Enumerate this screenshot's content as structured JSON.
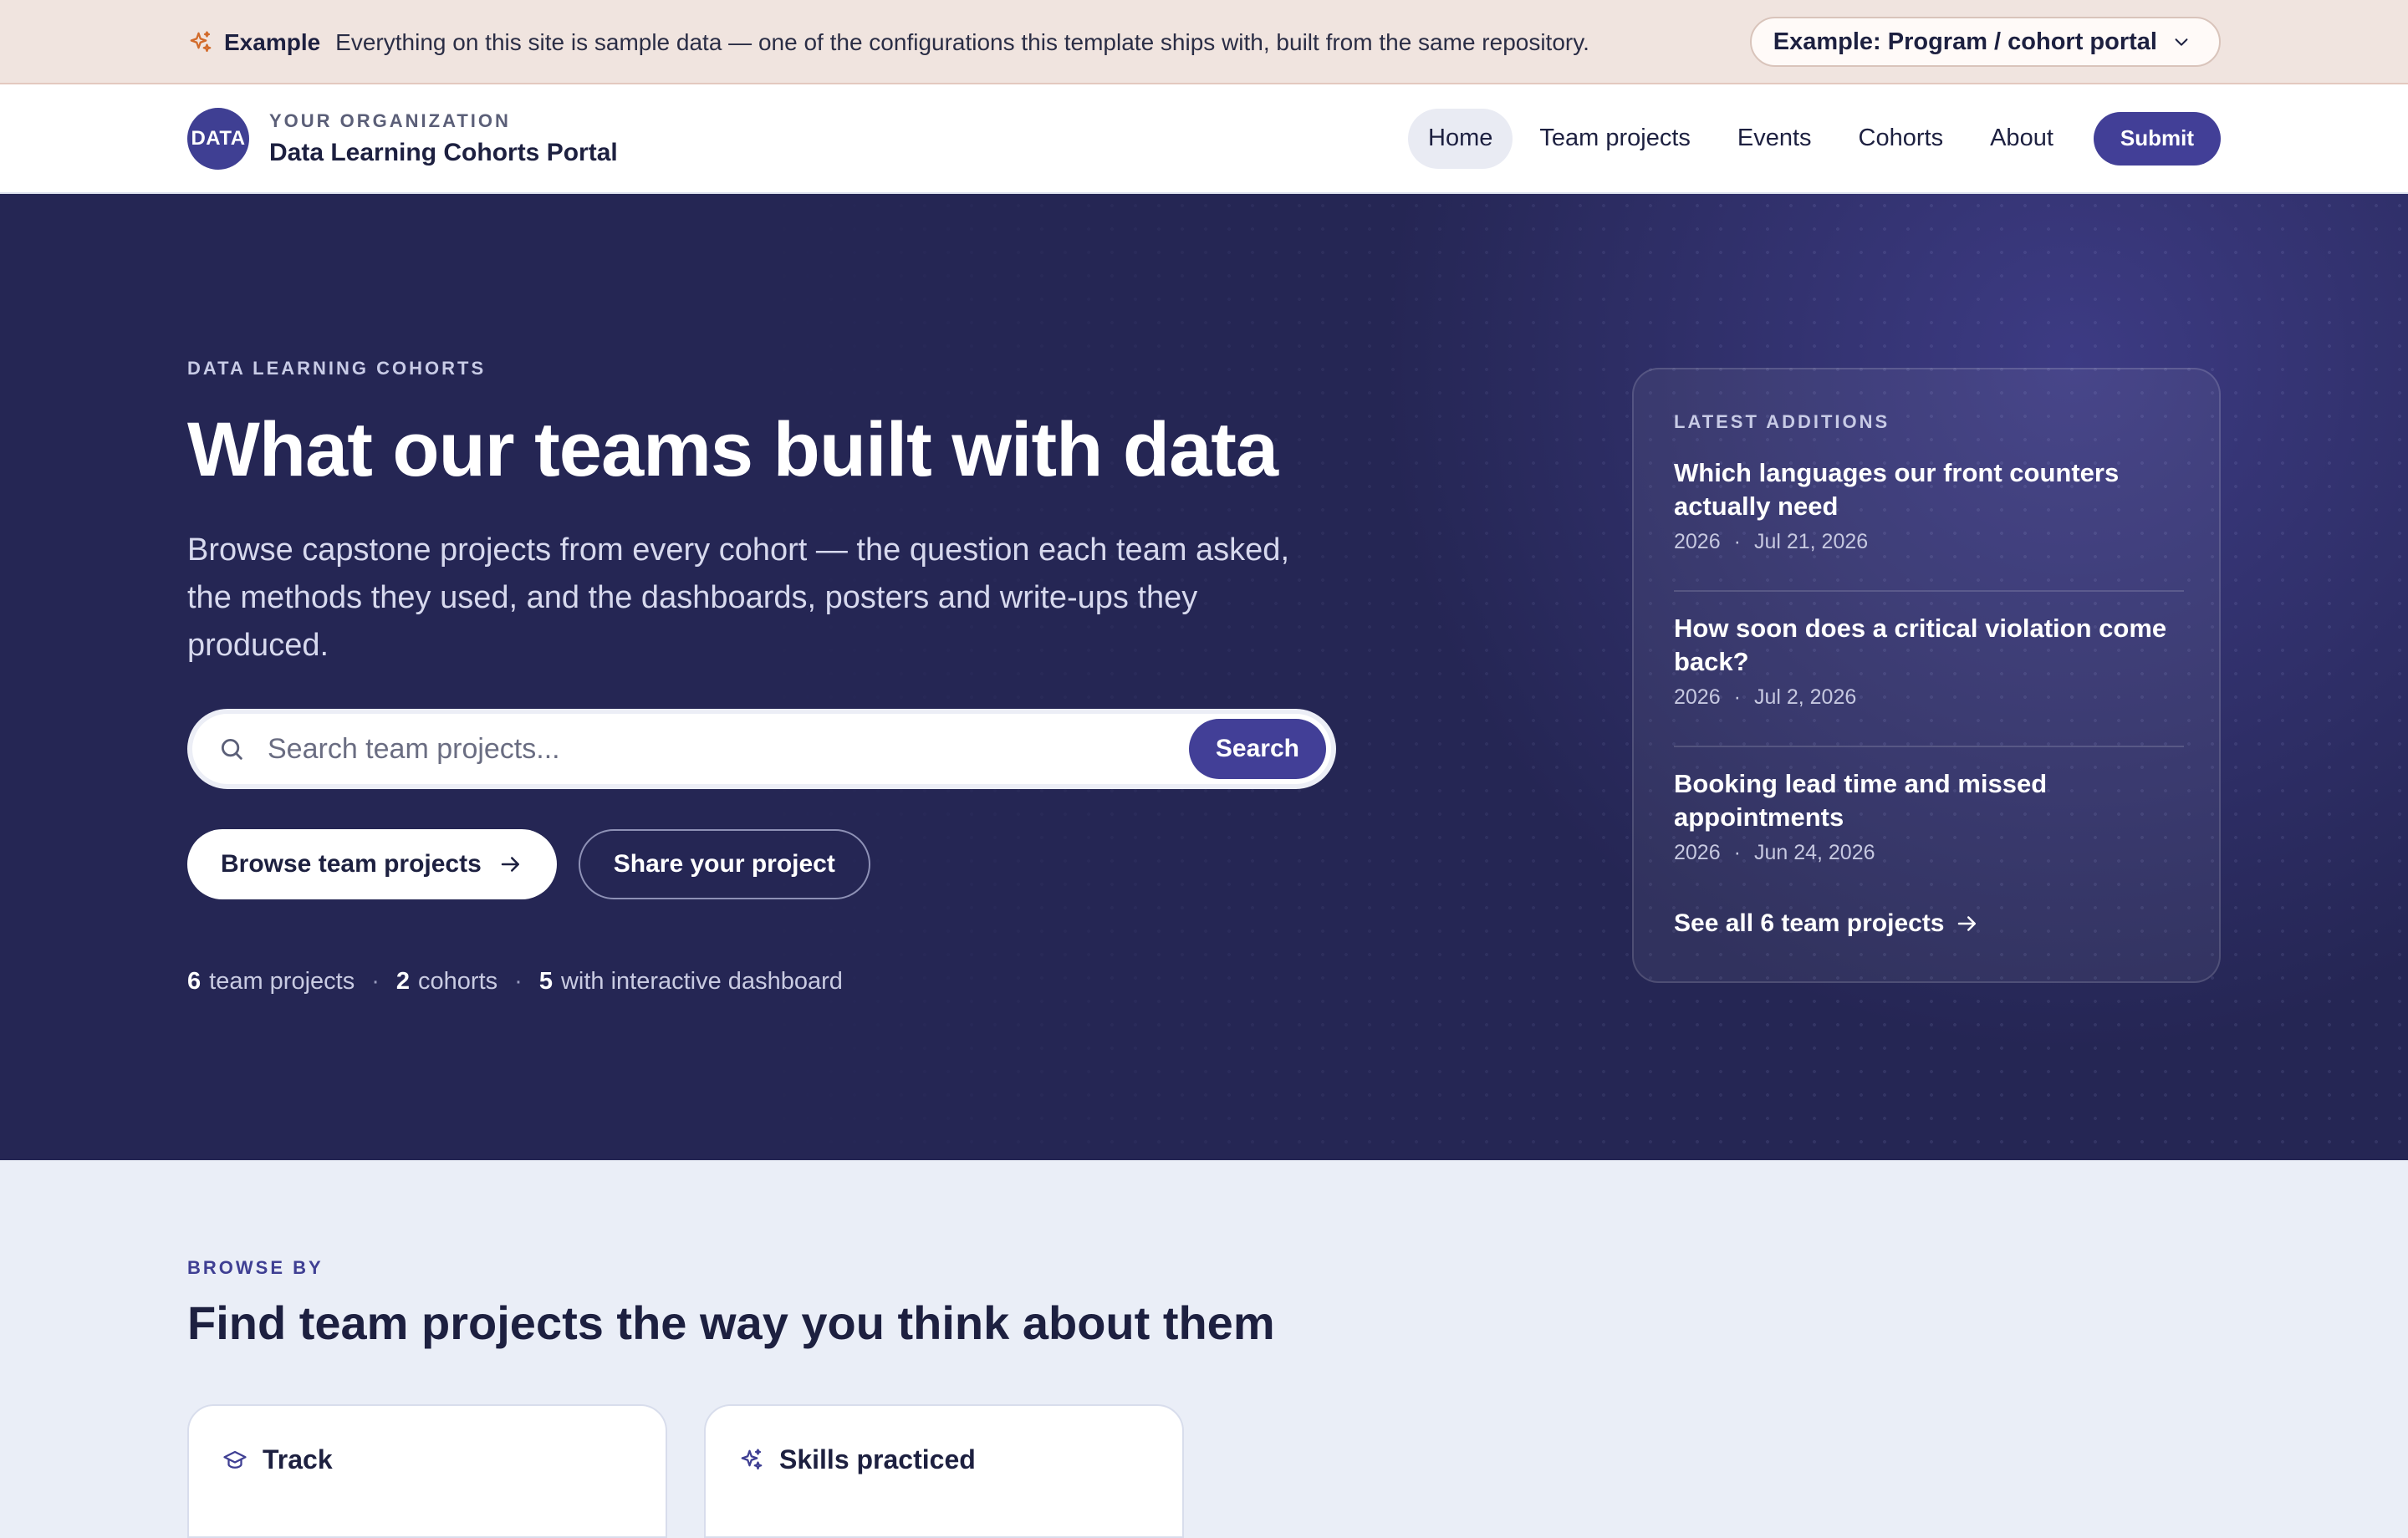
{
  "banner": {
    "label": "Example",
    "text": "Everything on this site is sample data — one of the configurations this template ships with, built from the same repository.",
    "config_select": "Example: Program / cohort portal"
  },
  "header": {
    "logo_text": "DATA",
    "org": "YOUR ORGANIZATION",
    "site_name": "Data Learning Cohorts Portal",
    "nav": [
      "Home",
      "Team projects",
      "Events",
      "Cohorts",
      "About"
    ],
    "active_nav": "Home",
    "submit_label": "Submit"
  },
  "hero": {
    "eyebrow": "DATA LEARNING COHORTS",
    "title": "What our teams built with data",
    "subtitle": "Browse capstone projects from every cohort — the question each team asked, the methods they used, and the dashboards, posters and write-ups they produced.",
    "search": {
      "placeholder": "Search team projects...",
      "button": "Search"
    },
    "primary_button": "Browse team projects",
    "secondary_button": "Share your project",
    "stats": [
      {
        "count": "6",
        "label": "team projects"
      },
      {
        "count": "2",
        "label": "cohorts"
      },
      {
        "count": "5",
        "label": "with interactive dashboard"
      }
    ]
  },
  "latest": {
    "eyebrow": "LATEST ADDITIONS",
    "items": [
      {
        "title": "Which languages our front counters actually need",
        "year": "2026",
        "date": "Jul 21, 2026"
      },
      {
        "title": "How soon does a critical violation come back?",
        "year": "2026",
        "date": "Jul 2, 2026"
      },
      {
        "title": "Booking lead time and missed appointments",
        "year": "2026",
        "date": "Jun 24, 2026"
      }
    ],
    "see_all": "See all 6 team projects"
  },
  "browse": {
    "eyebrow": "BROWSE BY",
    "title": "Find team projects the way you think about them",
    "cards": [
      {
        "label": "Track",
        "icon": "graduation-cap-icon"
      },
      {
        "label": "Skills practiced",
        "icon": "sparkles-icon"
      }
    ]
  },
  "colors": {
    "accent": "#423f97",
    "hero_bg": "#252654",
    "banner_bg": "#f0e4df",
    "page_bg": "#eaeef7"
  }
}
